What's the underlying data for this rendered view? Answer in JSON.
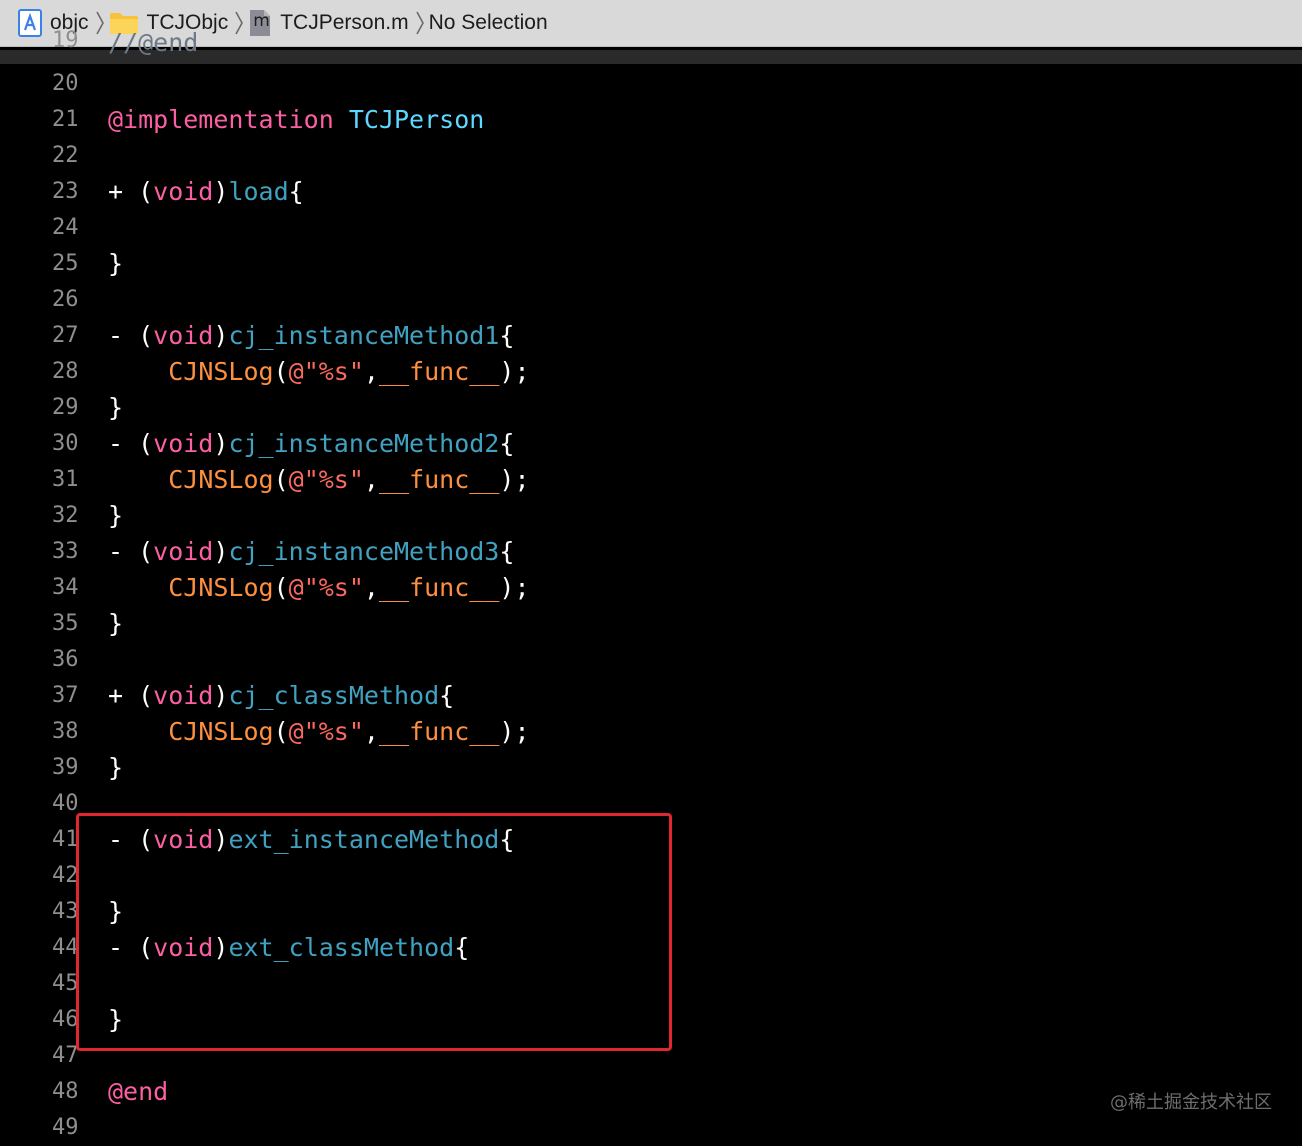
{
  "jumpbar": {
    "crumbs": [
      {
        "label": "objc",
        "icon": "xcode-project-icon"
      },
      {
        "label": "TCJObjc",
        "icon": "folder-icon"
      },
      {
        "label": "TCJPerson.m",
        "icon": "objc-m-file-icon",
        "icon_letter": "m"
      },
      {
        "label": "No Selection",
        "icon": ""
      }
    ]
  },
  "colors": {
    "keyword": "#fc5fa3",
    "class_name": "#5dd8ff",
    "method_name": "#41a1c0",
    "macro": "#fd8f3f",
    "string": "#fc6a5d",
    "plain": "#ffffff",
    "line_number": "#8f8f8f",
    "comment": "#6c7986",
    "highlight_border": "#e0262e"
  },
  "editor": {
    "partial_top_line": {
      "number": "19",
      "text": "//@end"
    },
    "lines": [
      {
        "num": "20",
        "tokens": []
      },
      {
        "num": "21",
        "tokens": [
          {
            "t": "@implementation",
            "c": "keyword"
          },
          {
            "t": " ",
            "c": "plain"
          },
          {
            "t": "TCJPerson",
            "c": "class_name"
          }
        ]
      },
      {
        "num": "22",
        "tokens": []
      },
      {
        "num": "23",
        "tokens": [
          {
            "t": "+ (",
            "c": "plain"
          },
          {
            "t": "void",
            "c": "keyword"
          },
          {
            "t": ")",
            "c": "plain"
          },
          {
            "t": "load",
            "c": "method_name"
          },
          {
            "t": "{",
            "c": "plain"
          }
        ]
      },
      {
        "num": "24",
        "tokens": []
      },
      {
        "num": "25",
        "tokens": [
          {
            "t": "}",
            "c": "plain"
          }
        ]
      },
      {
        "num": "26",
        "tokens": []
      },
      {
        "num": "27",
        "tokens": [
          {
            "t": "- (",
            "c": "plain"
          },
          {
            "t": "void",
            "c": "keyword"
          },
          {
            "t": ")",
            "c": "plain"
          },
          {
            "t": "cj_instanceMethod1",
            "c": "method_name"
          },
          {
            "t": "{",
            "c": "plain"
          }
        ]
      },
      {
        "num": "28",
        "tokens": [
          {
            "t": "    ",
            "c": "plain"
          },
          {
            "t": "CJNSLog",
            "c": "macro"
          },
          {
            "t": "(",
            "c": "plain"
          },
          {
            "t": "@\"%s\"",
            "c": "string"
          },
          {
            "t": ",",
            "c": "plain"
          },
          {
            "t": "__func__",
            "c": "macro"
          },
          {
            "t": ");",
            "c": "plain"
          }
        ]
      },
      {
        "num": "29",
        "tokens": [
          {
            "t": "}",
            "c": "plain"
          }
        ]
      },
      {
        "num": "30",
        "tokens": [
          {
            "t": "- (",
            "c": "plain"
          },
          {
            "t": "void",
            "c": "keyword"
          },
          {
            "t": ")",
            "c": "plain"
          },
          {
            "t": "cj_instanceMethod2",
            "c": "method_name"
          },
          {
            "t": "{",
            "c": "plain"
          }
        ]
      },
      {
        "num": "31",
        "tokens": [
          {
            "t": "    ",
            "c": "plain"
          },
          {
            "t": "CJNSLog",
            "c": "macro"
          },
          {
            "t": "(",
            "c": "plain"
          },
          {
            "t": "@\"%s\"",
            "c": "string"
          },
          {
            "t": ",",
            "c": "plain"
          },
          {
            "t": "__func__",
            "c": "macro"
          },
          {
            "t": ");",
            "c": "plain"
          }
        ]
      },
      {
        "num": "32",
        "tokens": [
          {
            "t": "}",
            "c": "plain"
          }
        ]
      },
      {
        "num": "33",
        "tokens": [
          {
            "t": "- (",
            "c": "plain"
          },
          {
            "t": "void",
            "c": "keyword"
          },
          {
            "t": ")",
            "c": "plain"
          },
          {
            "t": "cj_instanceMethod3",
            "c": "method_name"
          },
          {
            "t": "{",
            "c": "plain"
          }
        ]
      },
      {
        "num": "34",
        "tokens": [
          {
            "t": "    ",
            "c": "plain"
          },
          {
            "t": "CJNSLog",
            "c": "macro"
          },
          {
            "t": "(",
            "c": "plain"
          },
          {
            "t": "@\"%s\"",
            "c": "string"
          },
          {
            "t": ",",
            "c": "plain"
          },
          {
            "t": "__func__",
            "c": "macro"
          },
          {
            "t": ");",
            "c": "plain"
          }
        ]
      },
      {
        "num": "35",
        "tokens": [
          {
            "t": "}",
            "c": "plain"
          }
        ]
      },
      {
        "num": "36",
        "tokens": []
      },
      {
        "num": "37",
        "tokens": [
          {
            "t": "+ (",
            "c": "plain"
          },
          {
            "t": "void",
            "c": "keyword"
          },
          {
            "t": ")",
            "c": "plain"
          },
          {
            "t": "cj_classMethod",
            "c": "method_name"
          },
          {
            "t": "{",
            "c": "plain"
          }
        ]
      },
      {
        "num": "38",
        "tokens": [
          {
            "t": "    ",
            "c": "plain"
          },
          {
            "t": "CJNSLog",
            "c": "macro"
          },
          {
            "t": "(",
            "c": "plain"
          },
          {
            "t": "@\"%s\"",
            "c": "string"
          },
          {
            "t": ",",
            "c": "plain"
          },
          {
            "t": "__func__",
            "c": "macro"
          },
          {
            "t": ");",
            "c": "plain"
          }
        ]
      },
      {
        "num": "39",
        "tokens": [
          {
            "t": "}",
            "c": "plain"
          }
        ]
      },
      {
        "num": "40",
        "tokens": []
      },
      {
        "num": "41",
        "tokens": [
          {
            "t": "- (",
            "c": "plain"
          },
          {
            "t": "void",
            "c": "keyword"
          },
          {
            "t": ")",
            "c": "plain"
          },
          {
            "t": "ext_instanceMethod",
            "c": "method_name"
          },
          {
            "t": "{",
            "c": "plain"
          }
        ]
      },
      {
        "num": "42",
        "tokens": []
      },
      {
        "num": "43",
        "tokens": [
          {
            "t": "}",
            "c": "plain"
          }
        ]
      },
      {
        "num": "44",
        "tokens": [
          {
            "t": "- (",
            "c": "plain"
          },
          {
            "t": "void",
            "c": "keyword"
          },
          {
            "t": ")",
            "c": "plain"
          },
          {
            "t": "ext_classMethod",
            "c": "method_name"
          },
          {
            "t": "{",
            "c": "plain"
          }
        ]
      },
      {
        "num": "45",
        "tokens": []
      },
      {
        "num": "46",
        "tokens": [
          {
            "t": "}",
            "c": "plain"
          }
        ]
      },
      {
        "num": "47",
        "tokens": []
      },
      {
        "num": "48",
        "tokens": [
          {
            "t": "@end",
            "c": "keyword"
          }
        ]
      },
      {
        "num": "49",
        "tokens": []
      }
    ]
  },
  "watermark": "@稀土掘金技术社区"
}
